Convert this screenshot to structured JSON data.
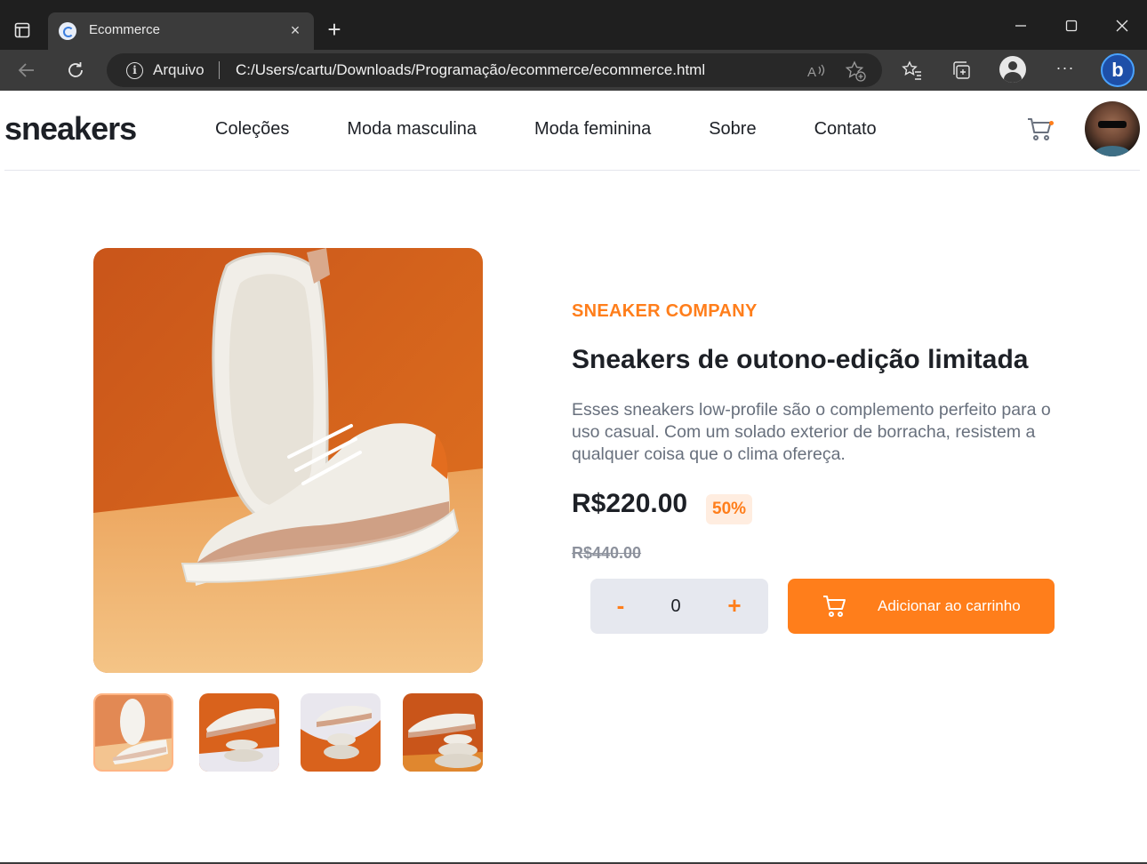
{
  "browser": {
    "tab": {
      "title": "Ecommerce",
      "close": "×"
    },
    "new_tab": "+",
    "address": {
      "site_label": "Arquivo",
      "url": "C:/Users/cartu/Downloads/Programação/ecommerce/ecommerce.html"
    },
    "more": "···",
    "copilot": "b"
  },
  "header": {
    "logo": "sneakers",
    "nav": [
      "Coleções",
      "Moda masculina",
      "Moda feminina",
      "Sobre",
      "Contato"
    ]
  },
  "product": {
    "company": "SNEAKER COMPANY",
    "title": "Sneakers de outono-edição limitada",
    "description": "Esses sneakers low-profile são o complemento perfeito para o uso casual. Com um solado exterior de borracha, resistem a qualquer coisa que o clima ofereça.",
    "price": "R$220.00",
    "discount": "50%",
    "old_price": "R$440.00",
    "quantity": {
      "minus": "-",
      "value": "0",
      "plus": "+"
    },
    "add_to_cart": "Adicionar ao carrinho",
    "thumbnails_count": 4,
    "active_thumbnail": 1
  },
  "colors": {
    "accent": "#ff7e1b",
    "accent_pale": "#ffede0",
    "text_dark": "#1d2026",
    "text_gray": "#68707d",
    "photo_orange": "#d9621c",
    "photo_floor": "#f0b16b"
  }
}
